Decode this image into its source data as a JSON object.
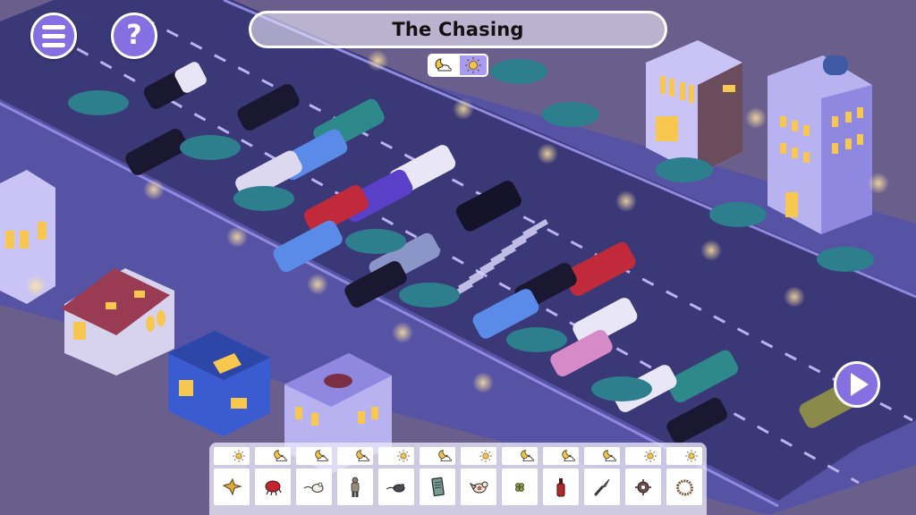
{
  "game": {
    "level_title": "The Chasing"
  },
  "buttons": {
    "menu": {
      "icon": "hamburger-menu-icon"
    },
    "help": {
      "icon": "question-mark-icon",
      "glyph": "?"
    },
    "play": {
      "icon": "play-icon"
    }
  },
  "mode_toggle": {
    "options": [
      {
        "id": "night",
        "icon": "moon-cloud-icon",
        "selected": true
      },
      {
        "id": "day",
        "icon": "sun-icon",
        "selected": false
      }
    ]
  },
  "colors": {
    "accent": "#8470e0",
    "ground": "#6a5f8c",
    "road": "#3b3a7a",
    "sidewalk": "#5a56a8",
    "lamp_glow": "#ffd27a",
    "window_light": "#f7c74f"
  },
  "items": [
    {
      "mode": "day",
      "name": "golden-star-cookie"
    },
    {
      "mode": "night",
      "name": "red-crab"
    },
    {
      "mode": "night",
      "name": "white-mouse"
    },
    {
      "mode": "night",
      "name": "trench-coat-man"
    },
    {
      "mode": "day",
      "name": "gray-rat"
    },
    {
      "mode": "night",
      "name": "notebook"
    },
    {
      "mode": "day",
      "name": "bird"
    },
    {
      "mode": "night",
      "name": "green-clover"
    },
    {
      "mode": "night",
      "name": "red-bottle"
    },
    {
      "mode": "night",
      "name": "knife"
    },
    {
      "mode": "day",
      "name": "gear"
    },
    {
      "mode": "day",
      "name": "bead-necklace"
    }
  ]
}
